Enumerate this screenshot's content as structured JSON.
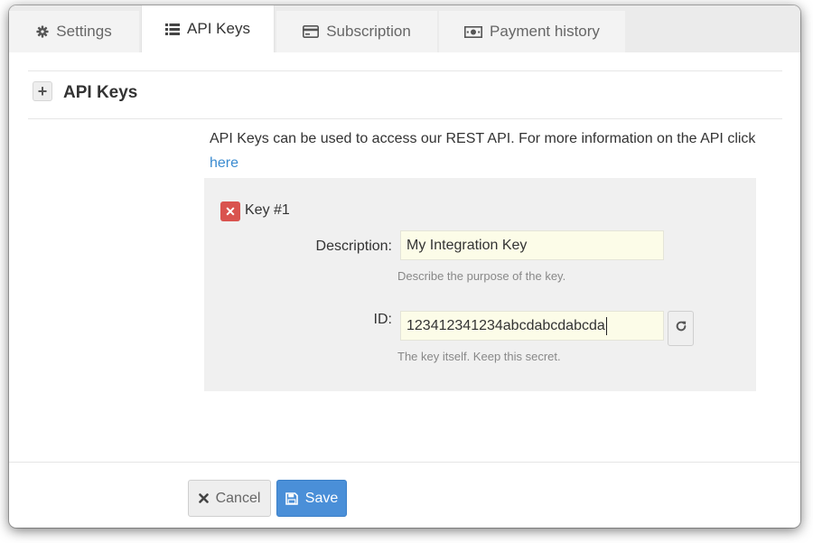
{
  "tabs": [
    {
      "label": "Settings",
      "icon": "gear-icon"
    },
    {
      "label": "API Keys",
      "icon": "list-icon",
      "active": true
    },
    {
      "label": "Subscription",
      "icon": "credit-card-icon"
    },
    {
      "label": "Payment history",
      "icon": "money-icon"
    }
  ],
  "section": {
    "title": "API Keys",
    "expand_icon": "plus-icon"
  },
  "intro": {
    "text": "API Keys can be used to access our REST API. For more information on the API click",
    "link_label": "here"
  },
  "key": {
    "title": "Key #1",
    "delete_icon": "close-icon",
    "description_label": "Description:",
    "description_value": "My Integration Key",
    "description_help": "Describe the purpose of the key.",
    "id_label": "ID:",
    "id_value": "123412341234abcdabcdabcda",
    "id_help": "The key itself. Keep this secret.",
    "refresh_icon": "refresh-icon"
  },
  "footer": {
    "cancel_label": "Cancel",
    "save_label": "Save"
  },
  "colors": {
    "accent": "#4a8fd8",
    "danger": "#d9534f",
    "link": "#3a8bd0",
    "field_bg": "#fcfce8",
    "panel_bg": "#f0f0f0"
  }
}
